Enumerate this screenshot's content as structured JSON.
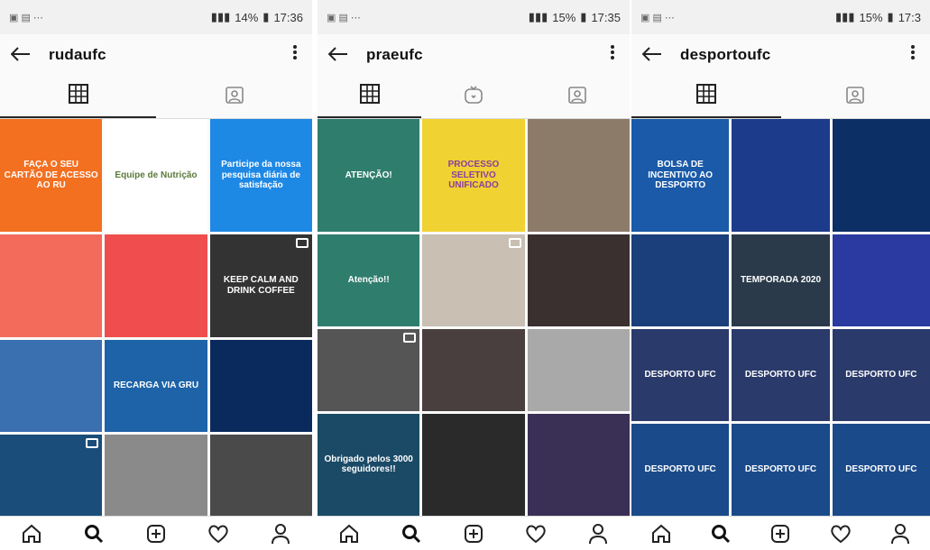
{
  "panels": [
    {
      "status_time": "17:36",
      "battery": "14%",
      "username": "rudaufc"
    },
    {
      "status_time": "17:35",
      "battery": "15%",
      "username": "praeufc"
    },
    {
      "status_time": "17:3",
      "battery": "15%",
      "username": "desportoufc"
    }
  ],
  "tiles_p0": [
    "FAÇA O SEU CARTÃO DE ACESSO AO RU",
    "Equipe de Nutrição",
    "Participe da nossa pesquisa diária de satisfação",
    "",
    "",
    "KEEP CALM AND DRINK COFFEE",
    "",
    "RECARGA VIA GRU",
    "",
    "",
    "",
    ""
  ],
  "tiles_p1": [
    "ATENÇÃO!",
    "PROCESSO SELETIVO UNIFICADO",
    "",
    "Atenção!!",
    "",
    "",
    "",
    "",
    "",
    "Obrigado pelos 3000 seguidores!!",
    "",
    ""
  ],
  "tiles_p2": [
    "BOLSA DE INCENTIVO AO DESPORTO",
    "",
    "",
    "",
    "TEMPORADA 2020",
    "",
    "DESPORTO UFC",
    "DESPORTO UFC",
    "DESPORTO UFC",
    "DESPORTO UFC",
    "DESPORTO UFC",
    "DESPORTO UFC"
  ],
  "colors": {
    "accent": "#262626",
    "status_bg": "#f1f1f1"
  },
  "icons": [
    "back-arrow-icon",
    "more-vert-icon",
    "grid-icon",
    "tagged-icon",
    "igtv-icon",
    "home-icon",
    "search-icon",
    "add-icon",
    "heart-icon",
    "profile-icon"
  ]
}
